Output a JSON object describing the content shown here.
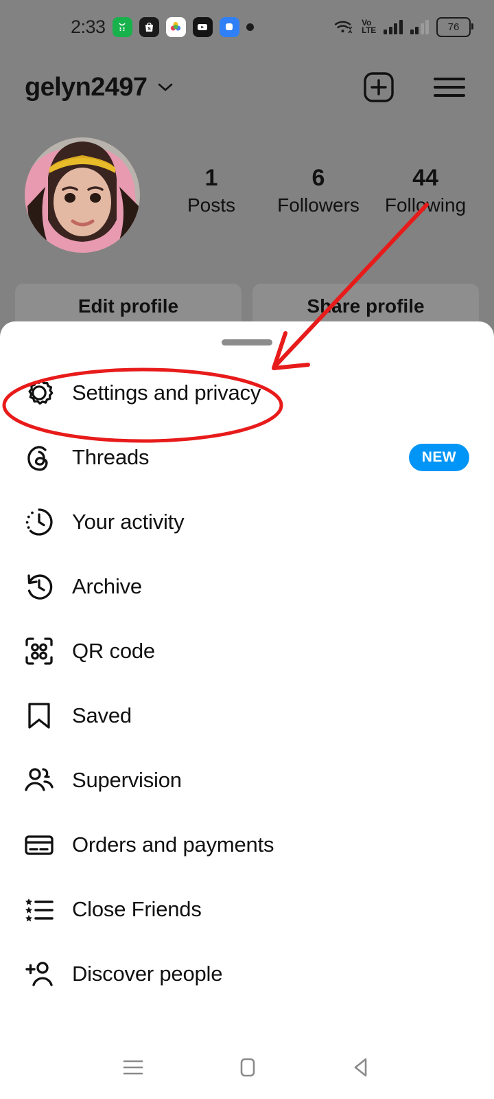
{
  "status_bar": {
    "time": "2:33",
    "app_icons": [
      {
        "name": "green-shopping-app-icon",
        "glyph": "☰"
      },
      {
        "name": "shopee-app-icon",
        "glyph": "S"
      },
      {
        "name": "colorful-star-app-icon",
        "glyph": "✦"
      },
      {
        "name": "youtube-app-icon",
        "glyph": "▶"
      },
      {
        "name": "messenger-app-icon",
        "glyph": "▢"
      }
    ],
    "network_label": "VoLTE",
    "volte_line1": "Vo",
    "volte_line2": "LTE",
    "battery_level": "76"
  },
  "profile": {
    "username": "gelyn2497",
    "stats": [
      {
        "value": "1",
        "label": "Posts"
      },
      {
        "value": "6",
        "label": "Followers"
      },
      {
        "value": "44",
        "label": "Following"
      }
    ],
    "buttons": [
      {
        "label": "Edit profile"
      },
      {
        "label": "Share profile"
      }
    ]
  },
  "sheet": {
    "menu_items": [
      {
        "label": "Settings and privacy",
        "icon": "gear-icon",
        "badge": ""
      },
      {
        "label": "Threads",
        "icon": "threads-icon",
        "badge": "NEW"
      },
      {
        "label": "Your activity",
        "icon": "activity-clock-icon",
        "badge": ""
      },
      {
        "label": "Archive",
        "icon": "archive-clock-icon",
        "badge": ""
      },
      {
        "label": "QR code",
        "icon": "qr-code-icon",
        "badge": ""
      },
      {
        "label": "Saved",
        "icon": "bookmark-icon",
        "badge": ""
      },
      {
        "label": "Supervision",
        "icon": "people-icon",
        "badge": ""
      },
      {
        "label": "Orders and payments",
        "icon": "credit-card-icon",
        "badge": ""
      },
      {
        "label": "Close Friends",
        "icon": "star-list-icon",
        "badge": ""
      },
      {
        "label": "Discover people",
        "icon": "person-add-icon",
        "badge": ""
      }
    ]
  },
  "colors": {
    "accent_blue": "#0095f6",
    "annotation_red": "#e81b1b",
    "dim_overlay": "#828282"
  }
}
